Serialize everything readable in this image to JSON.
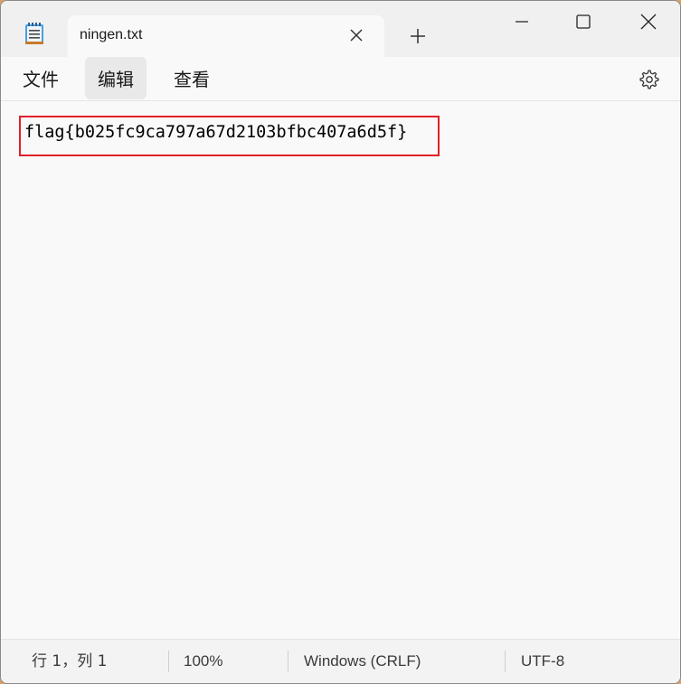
{
  "window": {
    "tab_title": "ningen.txt",
    "controls": {
      "minimize_icon": "minimize-icon",
      "maximize_icon": "maximize-icon",
      "close_icon": "close-icon"
    }
  },
  "menu": {
    "file": "文件",
    "edit": "编辑",
    "view": "查看"
  },
  "editor": {
    "content": "flag{b025fc9ca797a67d2103bfbc407a6d5f}",
    "highlight_color": "#e0202a"
  },
  "status": {
    "position": "行 1，列 1",
    "zoom": "100%",
    "line_ending": "Windows (CRLF)",
    "encoding": "UTF-8"
  },
  "colors": {
    "accent_icon": "#1c6fb6",
    "background": "#f9f9f9"
  }
}
